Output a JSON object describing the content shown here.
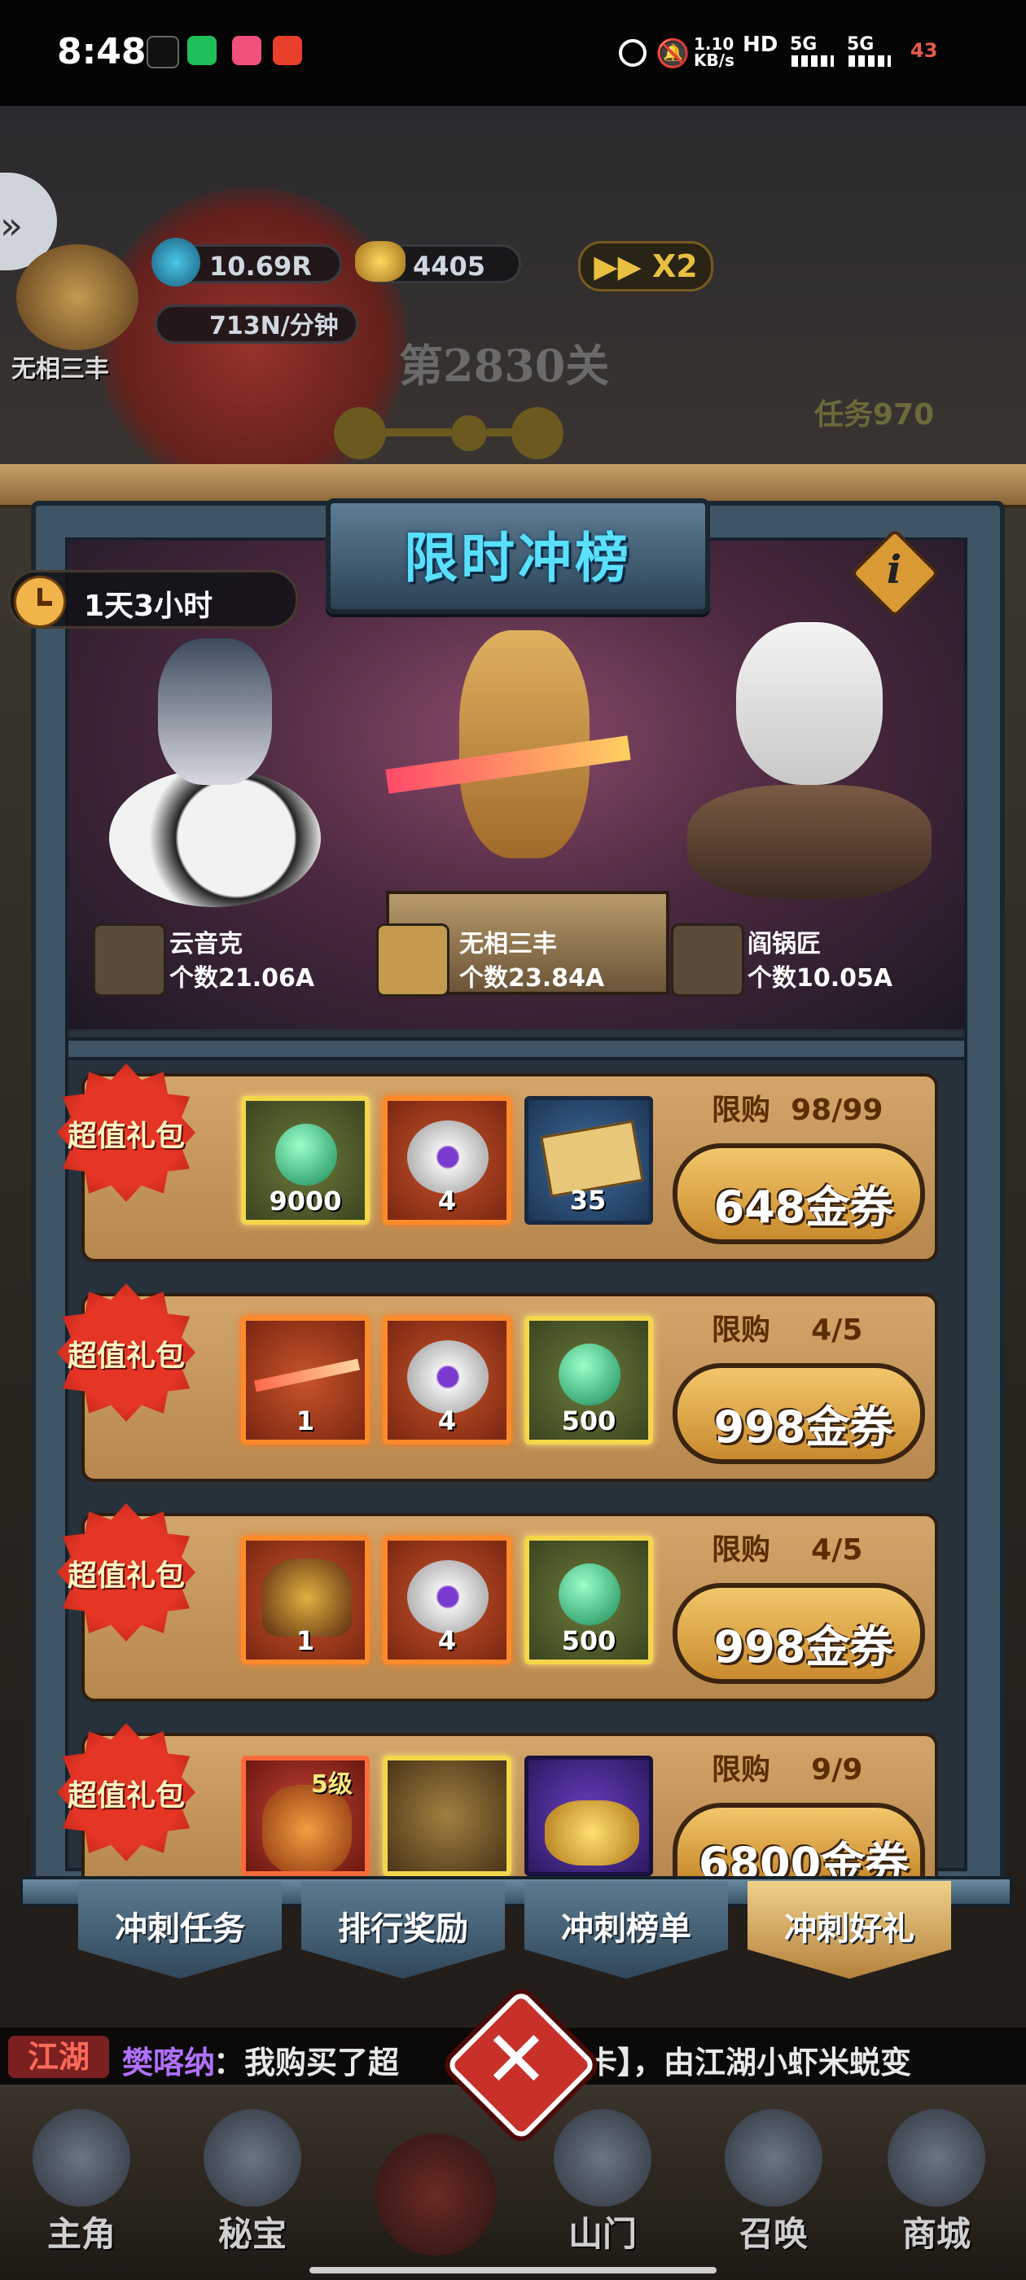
{
  "status_bar": {
    "time": "8:48",
    "speed": "1.10",
    "speed_unit": "KB/s",
    "hd": "HD",
    "net1": "5G",
    "net2": "5G",
    "battery": "43"
  },
  "hud": {
    "player_name": "无相三丰",
    "gems": "10.69R",
    "gold": "4405",
    "speed_label": "X2",
    "income": "713N/分钟",
    "stage": "第2830关",
    "task": "任务970"
  },
  "modal": {
    "title": "限时冲榜",
    "timer": "1天3小时",
    "info_label": "i",
    "podium": [
      {
        "name": "云音克",
        "count": "个数21.06A"
      },
      {
        "name": "无相三丰",
        "count": "个数23.84A"
      },
      {
        "name": "阎锅匠",
        "count": "个数10.05A"
      }
    ],
    "packs": [
      {
        "badge": "超值礼包",
        "items": [
          {
            "qty": "9000"
          },
          {
            "qty": "4"
          },
          {
            "qty": "35"
          }
        ],
        "limit_label": "限购",
        "limit": "98/99",
        "price": "648金券"
      },
      {
        "badge": "超值礼包",
        "items": [
          {
            "qty": "1"
          },
          {
            "qty": "4"
          },
          {
            "qty": "500"
          }
        ],
        "limit_label": "限购",
        "limit": "4/5",
        "price": "998金券"
      },
      {
        "badge": "超值礼包",
        "items": [
          {
            "qty": "1"
          },
          {
            "qty": "4"
          },
          {
            "qty": "500"
          }
        ],
        "limit_label": "限购",
        "limit": "4/5",
        "price": "998金券"
      },
      {
        "badge": "超值礼包",
        "items": [
          {
            "qty": "5级"
          },
          {
            "qty": ""
          },
          {
            "qty": ""
          }
        ],
        "limit_label": "限购",
        "limit": "9/9",
        "price": "6800金券"
      }
    ],
    "tabs": [
      "冲刺任务",
      "排行奖励",
      "冲刺榜单",
      "冲刺好礼"
    ]
  },
  "marquee": {
    "channel": "江湖",
    "user": "樊喀纳",
    "text": "：我购买了超",
    "tail": "卡】，由江湖小虾米蜕变"
  },
  "bottom_nav": [
    "主角",
    "秘宝",
    "山门",
    "召唤",
    "商城"
  ],
  "colors": {
    "accent_title": "#5ae0ff",
    "badge_red": "#e43525",
    "price_gold": "#f2c76a"
  }
}
